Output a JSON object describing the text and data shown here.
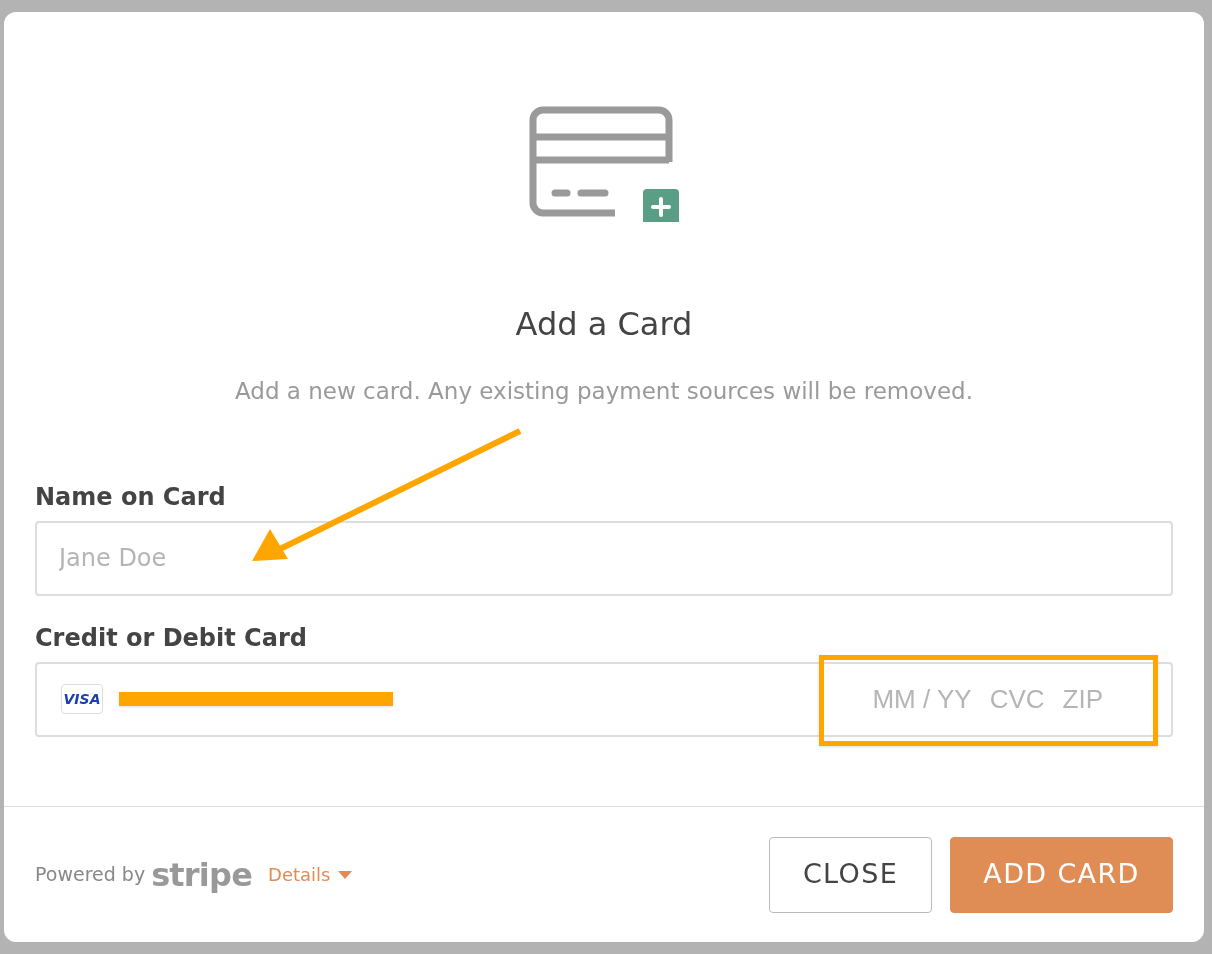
{
  "dialog": {
    "title": "Add a Card",
    "description": "Add a new card. Any existing payment sources will be removed.",
    "name_field": {
      "label": "Name on Card",
      "placeholder": "Jane Doe"
    },
    "card_field": {
      "label": "Credit or Debit Card",
      "brand": "VISA",
      "placeholders": [
        "MM / YY",
        "CVC",
        "ZIP"
      ]
    },
    "footer": {
      "powered_by": "Powered by",
      "brand": "stripe",
      "details_link": "Details"
    },
    "buttons": [
      {
        "label": "CLOSE",
        "kind": "secondary"
      },
      {
        "label": "ADD CARD",
        "kind": "primary"
      }
    ]
  }
}
